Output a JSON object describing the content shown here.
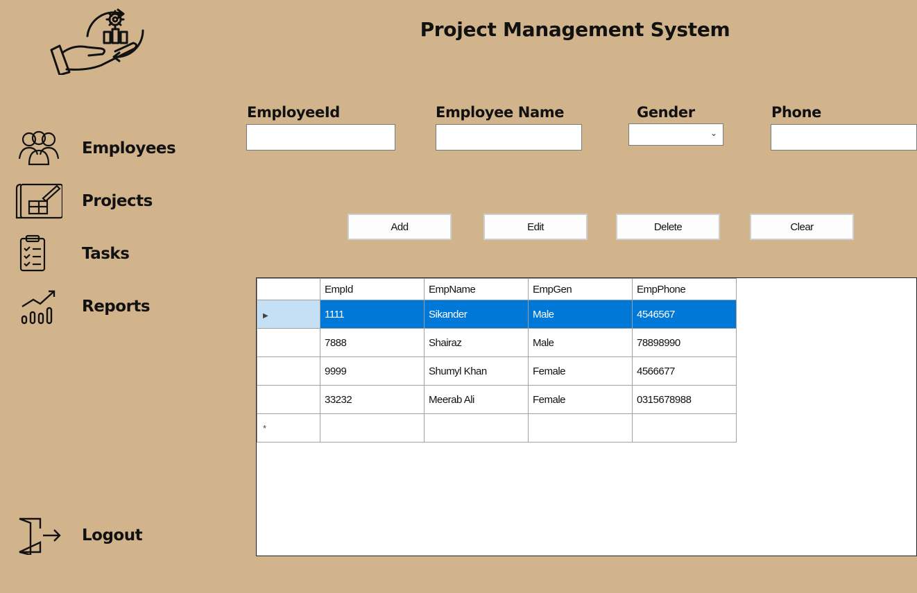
{
  "app": {
    "title": "Project Management System"
  },
  "sidebar": {
    "items": [
      {
        "label": "Employees",
        "icon": "people-icon"
      },
      {
        "label": "Projects",
        "icon": "blueprint-icon"
      },
      {
        "label": "Tasks",
        "icon": "clipboard-icon"
      },
      {
        "label": "Reports",
        "icon": "chart-icon"
      }
    ],
    "logout": {
      "label": "Logout",
      "icon": "logout-icon"
    }
  },
  "form": {
    "employee_id": {
      "label": "EmployeeId",
      "value": ""
    },
    "employee_name": {
      "label": "Employee Name",
      "value": ""
    },
    "gender": {
      "label": "Gender",
      "value": ""
    },
    "phone": {
      "label": "Phone",
      "value": ""
    }
  },
  "buttons": {
    "add": "Add",
    "edit": "Edit",
    "delete": "Delete",
    "clear": "Clear"
  },
  "grid": {
    "columns": [
      "EmpId",
      "EmpName",
      "EmpGen",
      "EmpPhone"
    ],
    "rows": [
      [
        "1111",
        "Sikander",
        "Male",
        "4546567"
      ],
      [
        "7888",
        "Shairaz",
        "Male",
        "78898990"
      ],
      [
        "9999",
        "Shumyl Khan",
        "Female",
        "4566677"
      ],
      [
        "33232",
        "Meerab Ali",
        "Female",
        "0315678988"
      ]
    ],
    "selected_row": 0,
    "current_row_marker": "▶",
    "new_row_marker": "*"
  },
  "colors": {
    "background": "#d2b48c",
    "selection": "#0078d7",
    "row_header_selected": "#c5dff5"
  }
}
